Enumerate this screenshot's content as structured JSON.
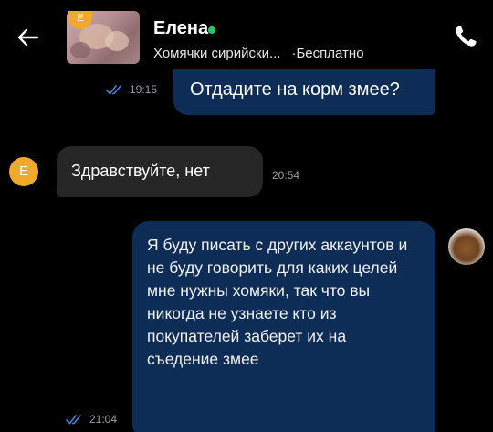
{
  "header": {
    "contact_name": "Елена",
    "listing_badge": "E",
    "listing_title": "Хомячки сирийски...",
    "listing_price": "·Бесплатно",
    "online_color": "#2ac46a",
    "back_icon": "arrow-left-icon",
    "call_icon": "phone-icon"
  },
  "messages": [
    {
      "direction": "outgoing",
      "text": "Отдадите на корм змее?",
      "time": "19:15",
      "status": "read"
    },
    {
      "direction": "incoming",
      "sender_initial": "E",
      "text": "Здравствуйте, нет",
      "time": "20:54"
    },
    {
      "direction": "outgoing",
      "text": "Я буду писать с других аккаунтов и не буду говорить для каких целей мне нужны хомяки, так что вы никогда не узнаете кто из покупателей заберет их на съедение змее",
      "time": "21:04",
      "status": "read"
    }
  ],
  "colors": {
    "background": "#000000",
    "outgoing_bubble": "#0d2c56",
    "incoming_bubble": "#262626",
    "avatar_accent": "#f0a92a",
    "meta_text": "#9aa0a8"
  }
}
